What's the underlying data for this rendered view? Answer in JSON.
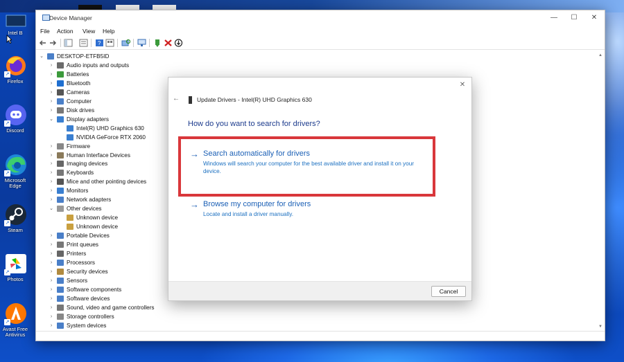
{
  "desktop": {
    "icons": [
      {
        "label": "Intel B",
        "icon": "intel-app-icon"
      },
      {
        "label": "Firefox",
        "icon": "firefox-icon"
      },
      {
        "label": "Discord",
        "icon": "discord-icon"
      },
      {
        "label": "Microsoft Edge",
        "icon": "edge-icon"
      },
      {
        "label": "Steam",
        "icon": "steam-icon"
      },
      {
        "label": "Photos",
        "icon": "photos-icon"
      },
      {
        "label": "Avast Free Antivirus",
        "icon": "avast-icon"
      }
    ]
  },
  "device_manager": {
    "title": "Device Manager",
    "controls": {
      "minimize": "—",
      "maximize": "☐",
      "close": "✕"
    },
    "menu": [
      "File",
      "Action",
      "View",
      "Help"
    ],
    "root": "DESKTOP-ETFB5ID",
    "tree": [
      {
        "label": "Audio inputs and outputs",
        "expanded": false
      },
      {
        "label": "Batteries",
        "expanded": false
      },
      {
        "label": "Bluetooth",
        "expanded": false
      },
      {
        "label": "Cameras",
        "expanded": false
      },
      {
        "label": "Computer",
        "expanded": false
      },
      {
        "label": "Disk drives",
        "expanded": false
      },
      {
        "label": "Display adapters",
        "expanded": true
      },
      {
        "label": "Intel(R) UHD Graphics 630",
        "child": true
      },
      {
        "label": "NVIDIA GeForce RTX 2060",
        "child": true
      },
      {
        "label": "Firmware",
        "expanded": false
      },
      {
        "label": "Human Interface Devices",
        "expanded": false
      },
      {
        "label": "Imaging devices",
        "expanded": false
      },
      {
        "label": "Keyboards",
        "expanded": false
      },
      {
        "label": "Mice and other pointing devices",
        "expanded": false
      },
      {
        "label": "Monitors",
        "expanded": false
      },
      {
        "label": "Network adapters",
        "expanded": false
      },
      {
        "label": "Other devices",
        "expanded": true
      },
      {
        "label": "Unknown device",
        "child": true
      },
      {
        "label": "Unknown device",
        "child": true
      },
      {
        "label": "Portable Devices",
        "expanded": false
      },
      {
        "label": "Print queues",
        "expanded": false
      },
      {
        "label": "Printers",
        "expanded": false
      },
      {
        "label": "Processors",
        "expanded": false
      },
      {
        "label": "Security devices",
        "expanded": false
      },
      {
        "label": "Sensors",
        "expanded": false
      },
      {
        "label": "Software components",
        "expanded": false
      },
      {
        "label": "Software devices",
        "expanded": false
      },
      {
        "label": "Sound, video and game controllers",
        "expanded": false
      },
      {
        "label": "Storage controllers",
        "expanded": false
      },
      {
        "label": "System devices",
        "expanded": false
      }
    ]
  },
  "dialog": {
    "title": "Update Drivers - Intel(R) UHD Graphics 630",
    "question": "How do you want to search for drivers?",
    "options": [
      {
        "title": "Search automatically for drivers",
        "desc": "Windows will search your computer for the best available driver and install it on your device."
      },
      {
        "title": "Browse my computer for drivers",
        "desc": "Locate and install a driver manually."
      }
    ],
    "cancel": "Cancel",
    "close": "✕",
    "back": "←"
  },
  "colors": {
    "link": "#1a5fb5",
    "highlight": "#d9373b",
    "heading": "#1b3a8c"
  }
}
